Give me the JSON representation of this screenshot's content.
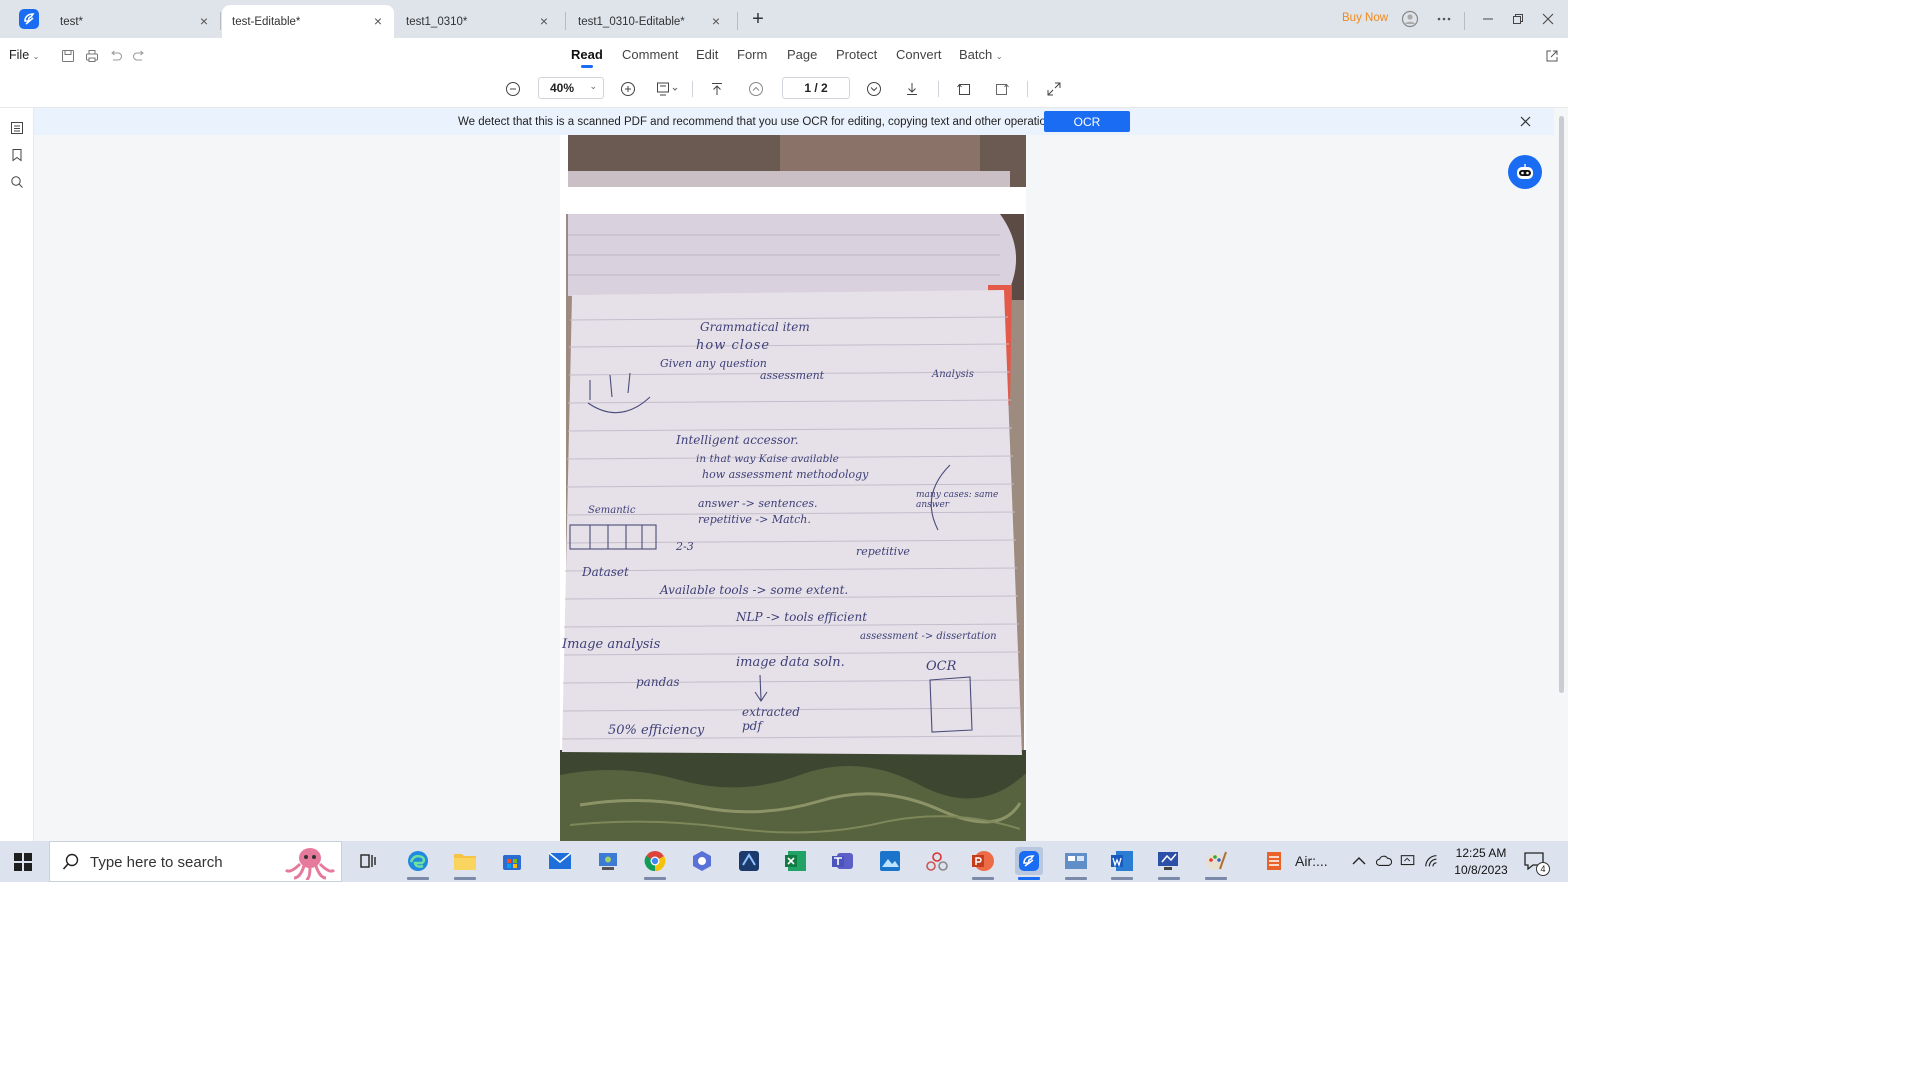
{
  "tabs": [
    {
      "label": "test*",
      "active": false
    },
    {
      "label": "test-Editable*",
      "active": true
    },
    {
      "label": "test1_0310*",
      "active": false
    },
    {
      "label": "test1_0310-Editable*",
      "active": false
    }
  ],
  "header": {
    "buy_now": "Buy Now",
    "file_menu": "File"
  },
  "nav_tabs": [
    "Read",
    "Comment",
    "Edit",
    "Form",
    "Page",
    "Protect",
    "Convert",
    "Batch"
  ],
  "active_nav_tab": "Read",
  "toolbar": {
    "zoom": "40%",
    "page_indicator": "1 / 2"
  },
  "ocr_banner": {
    "message": "We detect that this is a scanned PDF and recommend that you use OCR for editing, copying text and other operations.",
    "button_label": "OCR"
  },
  "document": {
    "notes_lines": [
      "Grammatical item",
      "how close",
      "Given any question",
      "assessment",
      "Analysis",
      "Intelligent accessor.",
      "in that way Kaise available",
      "how assessment methodology",
      "answer -> sentences.",
      "repetitive -> Match.",
      "many cases: same answer",
      "Semantic",
      "2-3",
      "repetitive",
      "Dataset",
      "Available tools -> some extent.",
      "NLP -> tools efficient",
      "assessment -> dissertation",
      "Image analysis",
      "image data soln.",
      "OCR",
      "pandas",
      "extracted pdf",
      "50% efficiency"
    ]
  },
  "taskbar": {
    "search_placeholder": "Type here to search",
    "air_label": "Air:...",
    "time": "12:25 AM",
    "date": "10/8/2023",
    "notification_count": "4"
  },
  "colors": {
    "accent": "#1a6cf2",
    "buy_now": "#f08a1c",
    "banner_bg": "#eaf2fd"
  }
}
